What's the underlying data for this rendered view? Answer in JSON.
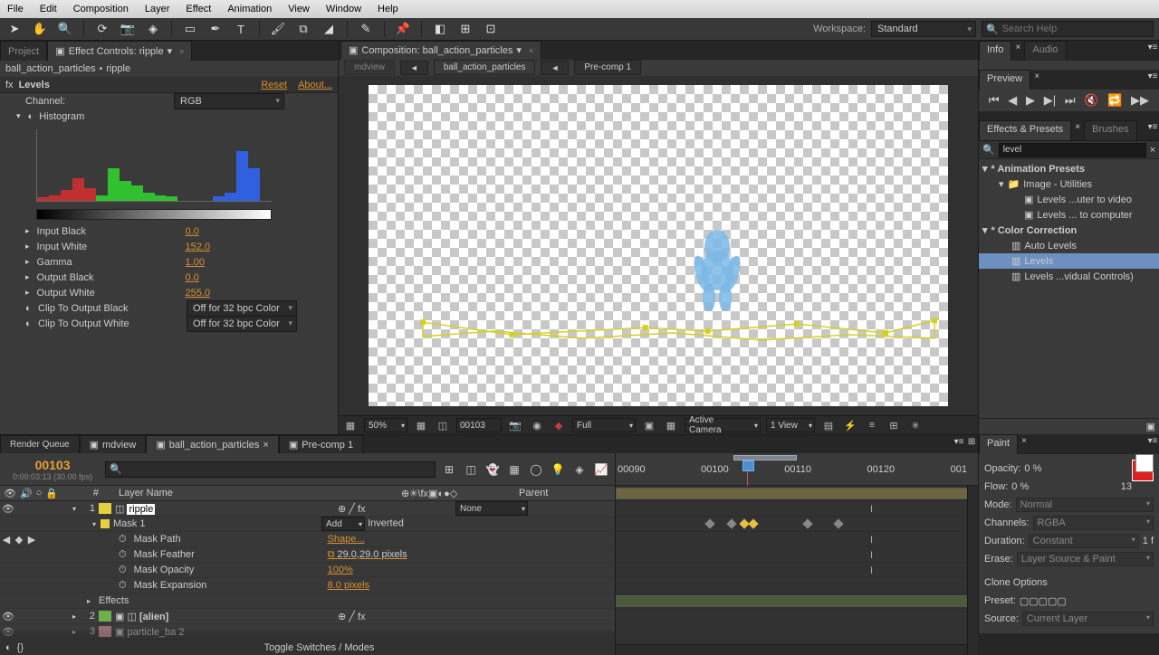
{
  "menu": [
    "File",
    "Edit",
    "Composition",
    "Layer",
    "Effect",
    "Animation",
    "View",
    "Window",
    "Help"
  ],
  "toolbar": {
    "workspace_label": "Workspace:",
    "workspace_value": "Standard",
    "search_placeholder": "Search Help"
  },
  "left_panel": {
    "tab_project": "Project",
    "tab_effect_controls": "Effect Controls: ripple",
    "breadcrumb_comp": "ball_action_particles",
    "breadcrumb_layer": "ripple",
    "effect_name": "Levels",
    "reset": "Reset",
    "about": "About...",
    "channel_label": "Channel:",
    "channel_value": "RGB",
    "histogram_label": "Histogram",
    "props": {
      "input_black_l": "Input Black",
      "input_black_v": "0.0",
      "input_white_l": "Input White",
      "input_white_v": "152.0",
      "gamma_l": "Gamma",
      "gamma_v": "1.00",
      "output_black_l": "Output Black",
      "output_black_v": "0.0",
      "output_white_l": "Output White",
      "output_white_v": "255.0",
      "clip_black_l": "Clip To Output Black",
      "clip_black_v": "Off for 32 bpc Color",
      "clip_white_l": "Clip To Output White",
      "clip_white_v": "Off for 32 bpc Color"
    }
  },
  "viewer": {
    "tab_composition": "Composition: ball_action_particles",
    "flow_mdview": "mdview",
    "flow_comp": "ball_action_particles",
    "flow_precomp": "Pre-comp 1",
    "zoom": "50%",
    "frame": "00103",
    "resolution": "Full",
    "camera": "Active Camera",
    "views": "1 View"
  },
  "right_panel": {
    "info_tab": "Info",
    "audio_tab": "Audio",
    "preview_tab": "Preview",
    "effects_presets_tab": "Effects & Presets",
    "brushes_tab": "Brushes",
    "search_value": "level",
    "tree": {
      "anim_presets": "* Animation Presets",
      "image_utils": "Image - Utilities",
      "levels_to_video": "Levels ...uter to video",
      "levels_to_computer": "Levels ... to computer",
      "color_correction": "* Color Correction",
      "auto_levels": "Auto Levels",
      "levels": "Levels",
      "levels_ind": "Levels ...vidual Controls)"
    }
  },
  "timeline": {
    "tabs": {
      "render_queue": "Render Queue",
      "mdview": "mdview",
      "current": "ball_action_particles",
      "precomp": "Pre-comp 1"
    },
    "current_frame": "00103",
    "timecode": "0:00:03:13 (30.00 fps)",
    "search_placeholder": "",
    "col_num": "#",
    "col_layer_name": "Layer Name",
    "col_parent": "Parent",
    "layer1": {
      "num": "1",
      "name": "ripple",
      "parent": "None"
    },
    "mask1": "Mask 1",
    "mask_mode": "Add",
    "mask_inverted": "Inverted",
    "mask_path_l": "Mask Path",
    "mask_path_v": "Shape...",
    "mask_feather_l": "Mask Feather",
    "mask_feather_v": "29.0,29.0 pixels",
    "mask_opacity_l": "Mask Opacity",
    "mask_opacity_v": "100%",
    "mask_expansion_l": "Mask Expansion",
    "mask_expansion_v": "8.0 pixels",
    "effects_l": "Effects",
    "layer2": {
      "num": "2",
      "name": "[alien]"
    },
    "layer3": {
      "num": "3",
      "name": "particle_ba 2"
    },
    "ruler": [
      "00090",
      "00100",
      "00110",
      "00120",
      "001"
    ],
    "footer_toggle": "Toggle Switches / Modes"
  },
  "paint": {
    "tab": "Paint",
    "opacity_l": "Opacity:",
    "opacity_v": "0 %",
    "flow_l": "Flow:",
    "flow_v": "0 %",
    "flow_num": "13",
    "mode_l": "Mode:",
    "mode_v": "Normal",
    "channels_l": "Channels:",
    "channels_v": "RGBA",
    "duration_l": "Duration:",
    "duration_v": "Constant",
    "duration_f": "1 f",
    "erase_l": "Erase:",
    "erase_v": "Layer Source & Paint",
    "clone_l": "Clone Options",
    "preset_l": "Preset:",
    "source_l": "Source:",
    "source_v": "Current Layer"
  }
}
